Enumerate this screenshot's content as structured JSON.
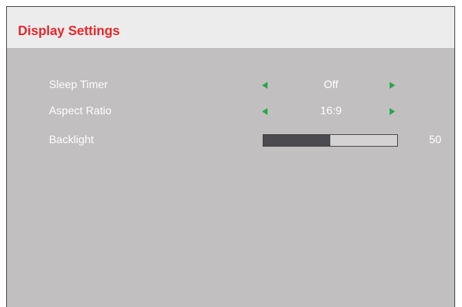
{
  "title": "Display Settings",
  "colors": {
    "title": "#e8262a",
    "header_bg": "#ececec",
    "panel_bg": "#c1bfbf",
    "arrow": "#21a94b",
    "text": "#ffffff",
    "slider_fill": "#4a4a4f",
    "slider_track": "#d4d2d2"
  },
  "settings": [
    {
      "label": "Sleep Timer",
      "value": "Off",
      "control": "selector",
      "left_icon": "triangle-left-icon",
      "right_icon": "triangle-right-icon"
    },
    {
      "label": "Aspect Ratio",
      "value": "16:9",
      "control": "selector",
      "left_icon": "triangle-left-icon",
      "right_icon": "triangle-right-icon"
    },
    {
      "label": "Backlight",
      "value": "50",
      "control": "slider",
      "level": 0.5
    }
  ]
}
